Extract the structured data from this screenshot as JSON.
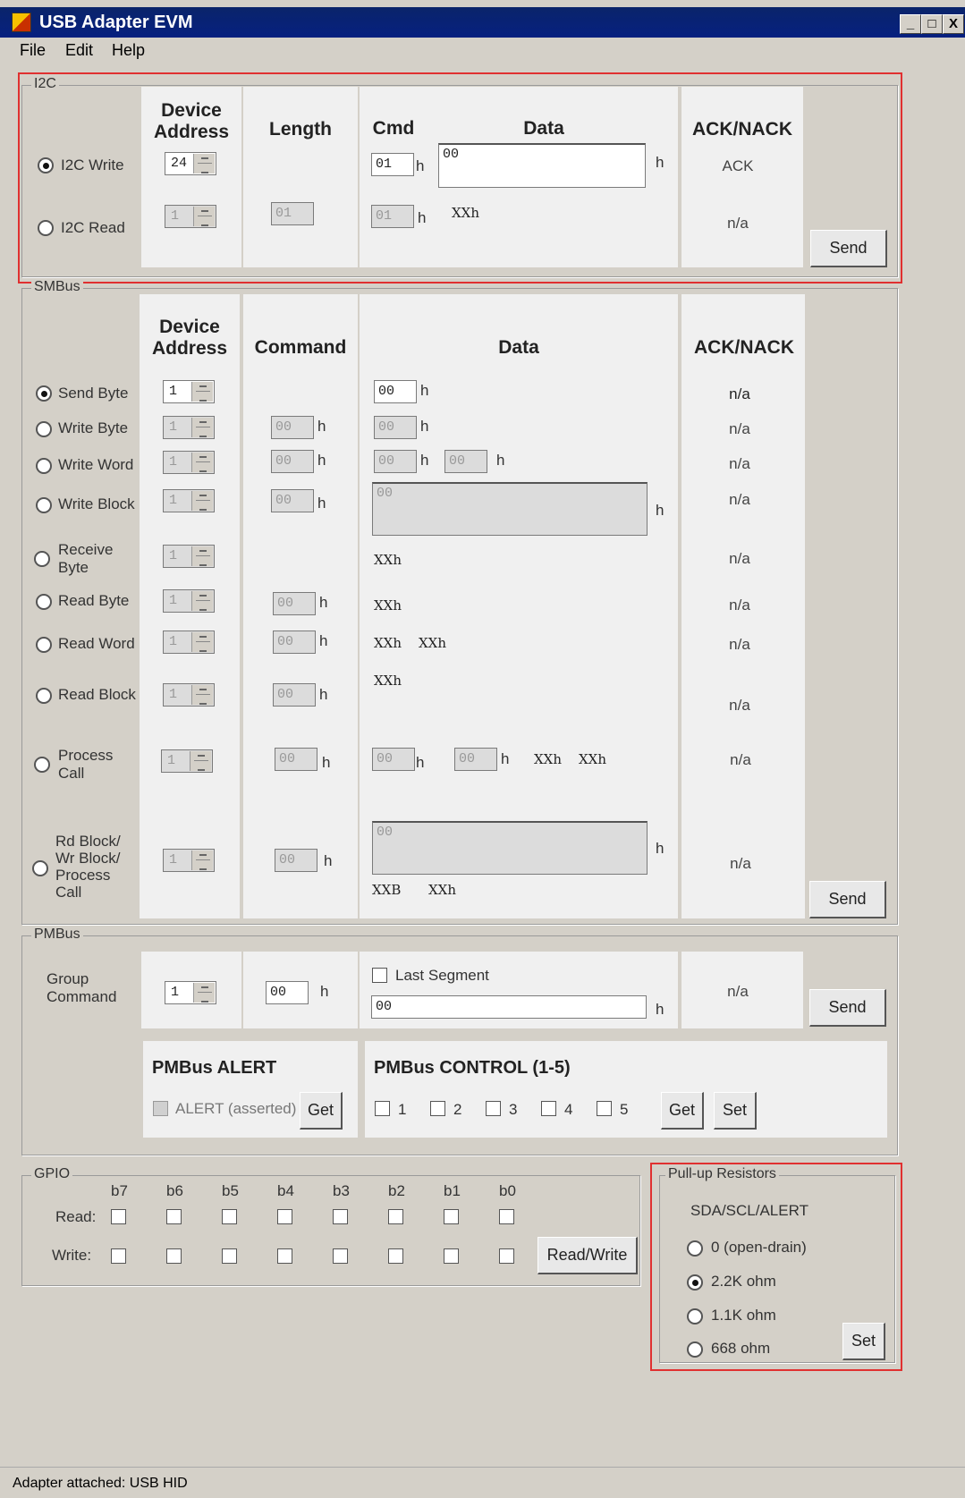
{
  "window": {
    "title": "USB Adapter EVM",
    "min": "_",
    "max": "□",
    "close": "X"
  },
  "menu": [
    "File",
    "Edit",
    "Help"
  ],
  "i2c": {
    "group": "I2C",
    "h_dev": "Device Address",
    "h_len": "Length",
    "h_cmd": "Cmd",
    "h_data": "Data",
    "h_ack": "ACK/NACK",
    "write_label": "I2C Write",
    "read_label": "I2C Read",
    "write_dev": "24",
    "read_dev": "1",
    "read_len": "01",
    "write_cmd": "01",
    "read_cmd": "01",
    "write_data": "00",
    "read_data": "XXh",
    "h": "h",
    "write_ack": "ACK",
    "read_ack": "n/a",
    "send": "Send"
  },
  "smbus": {
    "group": "SMBus",
    "h_dev": "Device Address",
    "h_cmd": "Command",
    "h_data": "Data",
    "h_ack": "ACK/NACK",
    "send": "Send",
    "rows": [
      {
        "label": "Send Byte",
        "selected": true,
        "dev": "1",
        "ack": "n/a"
      },
      {
        "label": "Write Byte",
        "selected": false,
        "dev": "1",
        "cmd": "00",
        "ack": "n/a"
      },
      {
        "label": "Write Word",
        "selected": false,
        "dev": "1",
        "cmd": "00",
        "ack": "n/a"
      },
      {
        "label": "Write Block",
        "selected": false,
        "dev": "1",
        "cmd": "00",
        "ack": "n/a"
      },
      {
        "label": "Receive Byte",
        "selected": false,
        "dev": "1",
        "ack": "n/a"
      },
      {
        "label": "Read Byte",
        "selected": false,
        "dev": "1",
        "cmd": "00",
        "ack": "n/a"
      },
      {
        "label": "Read Word",
        "selected": false,
        "dev": "1",
        "cmd": "00",
        "ack": "n/a"
      },
      {
        "label": "Read Block",
        "selected": false,
        "dev": "1",
        "cmd": "00",
        "ack": "n/a"
      },
      {
        "label": "Process Call",
        "selected": false,
        "dev": "1",
        "cmd": "00",
        "ack": "n/a"
      },
      {
        "label": "Rd Block/ Wr Block/ Process Call",
        "selected": false,
        "dev": "1",
        "cmd": "00",
        "ack": "n/a"
      }
    ],
    "send_byte_data": "00",
    "write_byte_data": "00",
    "write_word_lo": "00",
    "write_word_hi": "00",
    "write_block_data": "00",
    "receive_byte_data": "XXh",
    "read_byte_data": "XXh",
    "read_word_1": "XXh",
    "read_word_2": "XXh",
    "read_block_data": "XXh",
    "pc_lo": "00",
    "pc_hi": "00",
    "pc_r1": "XXh",
    "pc_r2": "XXh",
    "rbw_data": "00",
    "rbw_cnt": "XXB",
    "rbw_r": "XXh",
    "h": "h"
  },
  "pmbus": {
    "group": "PMBus",
    "group_cmd": "Group Command",
    "dev": "1",
    "cmd": "00",
    "last_segment": "Last Segment",
    "data": "00",
    "ack": "n/a",
    "send": "Send",
    "h": "h",
    "alert_title": "PMBus ALERT",
    "alert_label": "ALERT (asserted)",
    "alert_get": "Get",
    "control_title": "PMBus CONTROL (1-5)",
    "controls": [
      "1",
      "2",
      "3",
      "4",
      "5"
    ],
    "control_get": "Get",
    "control_set": "Set"
  },
  "gpio": {
    "group": "GPIO",
    "bits": [
      "b7",
      "b6",
      "b5",
      "b4",
      "b3",
      "b2",
      "b1",
      "b0"
    ],
    "read_label": "Read:",
    "write_label": "Write:",
    "rw_button": "Read/Write"
  },
  "pullup": {
    "group": "Pull-up Resistors",
    "subtitle": "SDA/SCL/ALERT",
    "options": [
      "0 (open-drain)",
      "2.2K ohm",
      "1.1K ohm",
      "668 ohm"
    ],
    "selected": "2.2K ohm",
    "set": "Set"
  },
  "status": "Adapter attached: USB HID"
}
